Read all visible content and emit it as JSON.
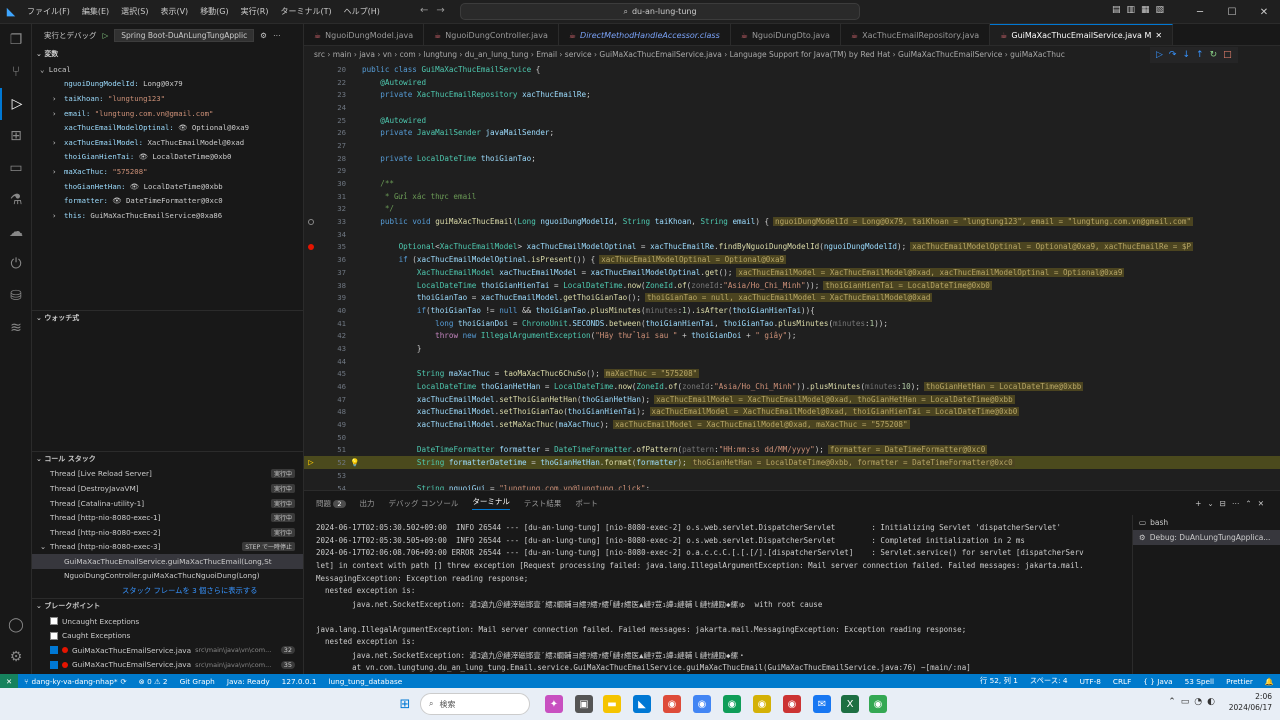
{
  "titlebar": {
    "menu": [
      "ファイル(F)",
      "編集(E)",
      "選択(S)",
      "表示(V)",
      "移動(G)",
      "実行(R)",
      "ターミナル(T)",
      "ヘルプ(H)"
    ],
    "search": "du-an-lung-tung"
  },
  "tabs": [
    {
      "label": "NguoiDungModel.java",
      "italic": false,
      "active": false
    },
    {
      "label": "NguoiDungController.java",
      "italic": false,
      "active": false
    },
    {
      "label": "DirectMethodHandleAccessor.class",
      "italic": true,
      "active": false
    },
    {
      "label": "NguoiDungDto.java",
      "italic": false,
      "active": false
    },
    {
      "label": "XacThucEmailRepository.java",
      "italic": false,
      "active": false
    },
    {
      "label": "GuiMaXacThucEmailService.java M",
      "italic": false,
      "active": true
    }
  ],
  "breadcrumb": "src › main › java › vn › com › lungtung › du_an_lung_tung › Email › service › GuiMaXacThucEmailService.java › Language Support for Java(TM) by Red Hat › GuiMaXacThucEmailService › guiMaXacThuc",
  "sidebar": {
    "header_label": "実行とデバッグ",
    "config": "Spring Boot-DuAnLungTungApplic",
    "variables_title": "変数",
    "local_label": "Local",
    "variables": [
      {
        "name": "nguoiDungModelId:",
        "value": "Long@0x79",
        "expand": false,
        "eye": false,
        "str": false
      },
      {
        "name": "taiKhoan:",
        "value": "\"lungtung123\"",
        "expand": true,
        "eye": false,
        "str": true
      },
      {
        "name": "email:",
        "value": "\"lungtung.com.vn@gmail.com\"",
        "expand": true,
        "eye": false,
        "str": true
      },
      {
        "name": "xacThucEmailModelOptinal:",
        "value": "Optional@0xa9",
        "expand": false,
        "eye": true,
        "str": false
      },
      {
        "name": "xacThucEmailModel:",
        "value": "XacThucEmailModel@0xad",
        "expand": true,
        "eye": false,
        "str": false
      },
      {
        "name": "thoiGianHienTai:",
        "value": "LocalDateTime@0xb0",
        "expand": false,
        "eye": true,
        "str": false
      },
      {
        "name": "maXacThuc:",
        "value": "\"575208\"",
        "expand": true,
        "eye": false,
        "str": true
      },
      {
        "name": "thoGianHetHan:",
        "value": "LocalDateTime@0xbb",
        "expand": false,
        "eye": true,
        "str": false
      },
      {
        "name": "formatter:",
        "value": "DateTimeFormatter@0xc0",
        "expand": false,
        "eye": true,
        "str": false
      },
      {
        "name": "this:",
        "value": "GuiMaXacThucEmailService@0xa86",
        "expand": true,
        "eye": false,
        "str": false
      }
    ],
    "watch_title": "ウォッチ式",
    "callstack_title": "コール スタック",
    "threads": [
      {
        "label": "Thread [Live Reload Server]",
        "badge": "実行中"
      },
      {
        "label": "Thread [DestroyJavaVM]",
        "badge": "実行中"
      },
      {
        "label": "Thread [Catalina-utility-1]",
        "badge": "実行中"
      },
      {
        "label": "Thread [http-nio-8080-exec-1]",
        "badge": "実行中"
      },
      {
        "label": "Thread [http-nio-8080-exec-2]",
        "badge": "実行中"
      },
      {
        "label": "Thread [http-nio-8080-exec-3]",
        "badge": "STEP で一時停止"
      }
    ],
    "frames": [
      "GuiMaXacThucEmailService.guiMaXacThucEmail(Long,St",
      "NguoiDungController.guiMaXacThucNguoiDung(Long)"
    ],
    "more_frames": "スタック フレームを 3 個さらに表示する",
    "breakpoints_title": "ブレークポイント",
    "breakpoints": [
      {
        "label": "Uncaught Exceptions",
        "path": "",
        "num": "",
        "checked": false,
        "dot": false
      },
      {
        "label": "Caught Exceptions",
        "path": "",
        "num": "",
        "checked": false,
        "dot": false
      },
      {
        "label": "GuiMaXacThucEmailService.java",
        "path": "src\\main\\java\\vn\\com...",
        "num": "32",
        "checked": true,
        "dot": true
      },
      {
        "label": "GuiMaXacThucEmailService.java",
        "path": "src\\main\\java\\vn\\com...",
        "num": "35",
        "checked": true,
        "dot": true
      },
      {
        "label": "NguoiDungController.java",
        "path": "src\\main\\java\\vn\\com\\lungt...",
        "num": "29",
        "checked": true,
        "dot": true
      }
    ]
  },
  "editor": {
    "lines": [
      {
        "n": "20",
        "code": "public class GuiMaXacThucEmailService {",
        "inline": "",
        "mark": "",
        "cur": false
      },
      {
        "n": "22",
        "code": "    @Autowired",
        "inline": "",
        "mark": "",
        "cur": false
      },
      {
        "n": "23",
        "code": "    private XacThucEmailRepository xacThucEmailRe;",
        "inline": "",
        "mark": "",
        "cur": false
      },
      {
        "n": "24",
        "code": "",
        "inline": "",
        "mark": "",
        "cur": false
      },
      {
        "n": "25",
        "code": "    @Autowired",
        "inline": "",
        "mark": "",
        "cur": false
      },
      {
        "n": "26",
        "code": "    private JavaMailSender javaMailSender;",
        "inline": "",
        "mark": "",
        "cur": false
      },
      {
        "n": "27",
        "code": "",
        "inline": "",
        "mark": "",
        "cur": false
      },
      {
        "n": "28",
        "code": "    private LocalDateTime thoiGianTao;",
        "inline": "",
        "mark": "",
        "cur": false
      },
      {
        "n": "29",
        "code": "",
        "inline": "",
        "mark": "",
        "cur": false
      },
      {
        "n": "30",
        "code": "    /**",
        "inline": "",
        "mark": "",
        "cur": false
      },
      {
        "n": "31",
        "code": "     * Gửi xác thực email",
        "inline": "",
        "mark": "",
        "cur": false
      },
      {
        "n": "32",
        "code": "     */",
        "inline": "",
        "mark": "",
        "cur": false
      },
      {
        "n": "33",
        "code": "    public void guiMaXacThucEmail(Long nguoiDungModelId, String taiKhoan, String email) {",
        "inline": "nguoiDungModelId = Long@0x79, taiKhoan = \"lungtung123\", email = \"lungtung.com.vn@gmail.com\"",
        "mark": "hollow",
        "cur": false
      },
      {
        "n": "34",
        "code": "",
        "inline": "",
        "mark": "",
        "cur": false
      },
      {
        "n": "35",
        "code": "        Optional<XacThucEmailModel> xacThucEmailModelOptinal = xacThucEmailRe.findByNguoiDungModelId(nguoiDungModelId);",
        "inline": "xacThucEmailModelOptinal = Optional@0xa9, xacThucEmailRe = $P",
        "mark": "dot",
        "cur": false
      },
      {
        "n": "36",
        "code": "        if (xacThucEmailModelOptinal.isPresent()) {",
        "inline": "xacThucEmailModelOptinal = Optional@0xa9",
        "mark": "",
        "cur": false
      },
      {
        "n": "37",
        "code": "            XacThucEmailModel xacThucEmailModel = xacThucEmailModelOptinal.get();",
        "inline": "xacThucEmailModel = XacThucEmailModel@0xad, xacThucEmailModelOptinal = Optional@0xa9",
        "mark": "",
        "cur": false
      },
      {
        "n": "38",
        "code": "            LocalDateTime thoiGianHienTai = LocalDateTime.now(ZoneId.of(zoneId:\"Asia/Ho_Chi_Minh\"));",
        "inline": "thoiGianHienTai = LocalDateTime@0xb0",
        "mark": "",
        "cur": false
      },
      {
        "n": "39",
        "code": "            thoiGianTao = xacThucEmailModel.getThoiGianTao();",
        "inline": "thoiGianTao = null, xacThucEmailModel = XacThucEmailModel@0xad",
        "mark": "",
        "cur": false
      },
      {
        "n": "40",
        "code": "            if(thoiGianTao != null && thoiGianTao.plusMinutes(minutes:1).isAfter(thoiGianHienTai)){",
        "inline": "",
        "mark": "",
        "cur": false
      },
      {
        "n": "41",
        "code": "                long thoiGianDoi = ChronoUnit.SECONDS.between(thoiGianHienTai, thoiGianTao.plusMinutes(minutes:1));",
        "inline": "",
        "mark": "",
        "cur": false
      },
      {
        "n": "42",
        "code": "                throw new IllegalArgumentException(\"Hãy thử lại sau \" + thoiGianDoi + \" giây\");",
        "inline": "",
        "mark": "",
        "cur": false
      },
      {
        "n": "43",
        "code": "            }",
        "inline": "",
        "mark": "",
        "cur": false
      },
      {
        "n": "44",
        "code": "",
        "inline": "",
        "mark": "",
        "cur": false
      },
      {
        "n": "45",
        "code": "            String maXacThuc = taoMaXacThuc6ChuSo();",
        "inline": "maXacThuc = \"575208\"",
        "mark": "",
        "cur": false
      },
      {
        "n": "46",
        "code": "            LocalDateTime thoGianHetHan = LocalDateTime.now(ZoneId.of(zoneId:\"Asia/Ho_Chi_Minh\")).plusMinutes(minutes:10);",
        "inline": "thoGianHetHan = LocalDateTime@0xbb",
        "mark": "",
        "cur": false
      },
      {
        "n": "47",
        "code": "            xacThucEmailModel.setThoiGianHetHan(thoGianHetHan);",
        "inline": "xacThucEmailModel = XacThucEmailModel@0xad, thoGianHetHan = LocalDateTime@0xbb",
        "mark": "",
        "cur": false
      },
      {
        "n": "48",
        "code": "            xacThucEmailModel.setThoiGianTao(thoiGianHienTai);",
        "inline": "xacThucEmailModel = XacThucEmailModel@0xad, thoiGianHienTai = LocalDateTime@0xb0",
        "mark": "",
        "cur": false
      },
      {
        "n": "49",
        "code": "            xacThucEmailModel.setMaXacThuc(maXacThuc);",
        "inline": "xacThucEmailModel = XacThucEmailModel@0xad, maXacThuc = \"575208\"",
        "mark": "",
        "cur": false
      },
      {
        "n": "50",
        "code": "",
        "inline": "",
        "mark": "",
        "cur": false
      },
      {
        "n": "51",
        "code": "            DateTimeFormatter formatter = DateTimeFormatter.ofPattern(pattern:\"HH:mm:ss dd/MM/yyyy\");",
        "inline": "formatter = DateTimeFormatter@0xc0",
        "mark": "",
        "cur": false
      },
      {
        "n": "52",
        "code": "            String formatterDatetime = thoGianHetHan.format(formatter);",
        "inline": "thoGianHetHan = LocalDateTime@0xbb, formatter = DateTimeFormatter@0xc0",
        "mark": "arrow",
        "cur": true
      },
      {
        "n": "53",
        "code": "",
        "inline": "",
        "mark": "",
        "cur": false
      },
      {
        "n": "54",
        "code": "            String nguoiGui = \"lungtung.com.vn@lungtung.click\";",
        "inline": "",
        "mark": "",
        "cur": false
      }
    ]
  },
  "panel": {
    "tabs": [
      "問題",
      "出力",
      "デバッグ コンソール",
      "ターミナル",
      "テスト結果",
      "ポート"
    ],
    "problems_count": "2",
    "terminal_lines": [
      "2024-06-17T02:05:30.502+09:00  INFO 26544 --- [du-an-lung-tung] [nio-8080-exec-2] o.s.web.servlet.DispatcherServlet        : Initializing Servlet 'dispatcherServlet'",
      "2024-06-17T02:05:30.505+09:00  INFO 26544 --- [du-an-lung-tung] [nio-8080-exec-2] o.s.web.servlet.DispatcherServlet        : Completed initialization in 2 ms",
      "2024-06-17T02:06:08.706+09:00 ERROR 26544 --- [du-an-lung-tung] [nio-8080-exec-2] o.a.c.c.C.[.[.[/].[dispatcherServlet]    : Servlet.service() for servlet [dispatcherServ",
      "let] in context with path [] threw exception [Request processing failed: java.lang.IllegalArgumentException: Mail server connection failed. Failed messages: jakarta.mail.",
      "MessagingException: Exception reading response;",
      "  nested exception is:",
      "        java.net.SocketException: 遒ｺ遶九＠縺滓磁邯壹′繧ｽ繝輔ヨ繧ｦ繧ｧ繧｢縺ｫ繧医▲縺ｦ荳ｭ譁ｭ縺輔ｌ縺ｾ縺励◆縲ゅ  with root cause",
      "",
      "java.lang.IllegalArgumentException: Mail server connection failed. Failed messages: jakarta.mail.MessagingException: Exception reading response;",
      "  nested exception is:",
      "        java.net.SocketException: 遒ｺ遶九＠縺滓磁邯壹′繧ｽ繝輔ヨ繧ｦ繧ｧ繧｢縺ｫ繧医▲縺ｦ荳ｭ譁ｭ縺輔ｌ縺ｾ縺励◆縲・",
      "        at vn.com.lungtung.du_an_lung_tung.Email.service.GuiMaXacThucEmailService.guiMaXacThucEmail(GuiMaXacThucEmailService.java:76) ~[main/:na]",
      "        at vn.com.lungtung.du_an_lung_tung.nguoidung.controller.NguoiDungController.guiMaXacThucNguoiDung(NguoiDungController.java:32) ~[main/:na]"
    ],
    "terminals": [
      "bash",
      "Debug: DuAnLungTungApplica..."
    ]
  },
  "statusbar": {
    "remote": "✕",
    "branch": "dang-ky-va-dang-nhap*",
    "problems": "⊗ 0 ⚠ 2",
    "git_graph": "Git Graph",
    "java": "Java: Ready",
    "ip": "127.0.0.1",
    "db": "lung_tung_database",
    "position": "行 52, 列 1",
    "spaces": "スペース: 4",
    "encoding": "UTF-8",
    "eol": "CRLF",
    "spell": "53 Spell",
    "prettier": "Prettier"
  },
  "taskbar": {
    "search": "検索",
    "time": "2:06",
    "date": "2024/06/17"
  },
  "colors": {
    "accent": "#0078d4",
    "statusbar": "#007acc",
    "breakpoint": "#e51400"
  }
}
